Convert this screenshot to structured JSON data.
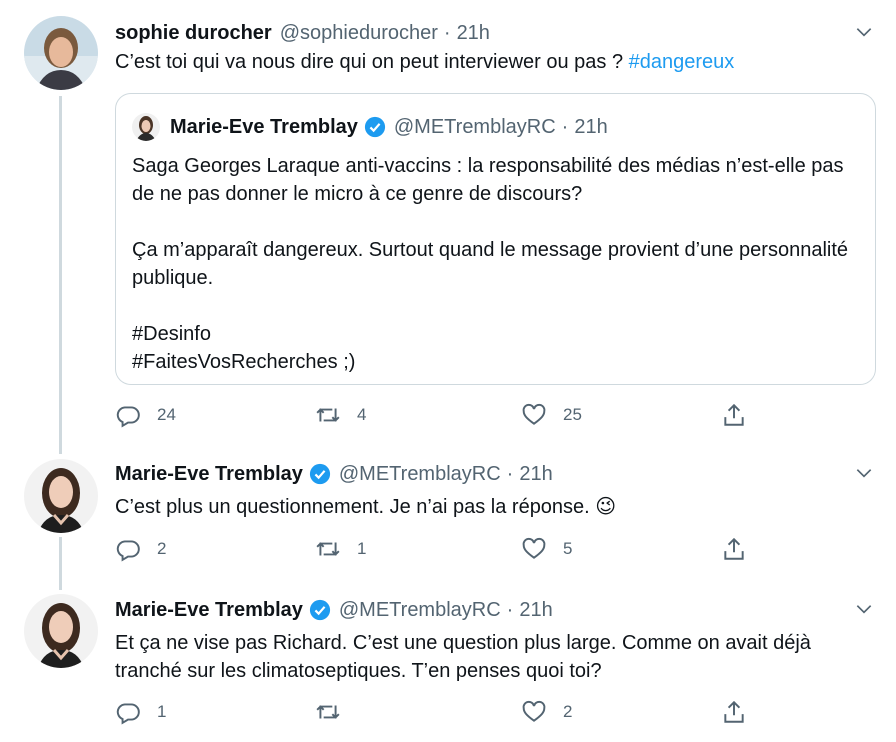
{
  "tweets": [
    {
      "name": "sophie durocher",
      "handle": "@sophiedurocher",
      "time": "21h",
      "text": "C’est toi qui va nous dire qui on peut interviewer ou pas ?",
      "hashtag": "#dangereux",
      "quoted": {
        "name": "Marie-Eve Tremblay",
        "handle": "@METremblayRC",
        "time": "21h",
        "line1": "Saga Georges Laraque anti-vaccins : la responsabilité des médias n’est-elle pas de ne pas donner le micro à ce genre de discours?",
        "line2": "Ça m’apparaît dangereux. Surtout quand le message provient d’une personnalité publique.",
        "tag1": "#Desinfo",
        "tag2": "#FaitesVosRecherches ;)"
      },
      "replies": "24",
      "retweets": "4",
      "likes": "25"
    },
    {
      "name": "Marie-Eve Tremblay",
      "handle": "@METremblayRC",
      "time": "21h",
      "text": "C’est plus un questionnement. Je n’ai pas la réponse. 😉",
      "replies": "2",
      "retweets": "1",
      "likes": "5"
    },
    {
      "name": "Marie-Eve Tremblay",
      "handle": "@METremblayRC",
      "time": "21h",
      "text": "Et ça ne vise pas Richard. C’est une question plus large. Comme on avait déjà tranché sur les climatoseptiques. T’en penses quoi toi?",
      "replies": "1",
      "retweets": "",
      "likes": "2"
    }
  ],
  "separator": "·",
  "icons": {
    "verified": "verified-badge-icon",
    "more": "chevron-down-icon",
    "reply": "reply-icon",
    "retweet": "retweet-icon",
    "like": "heart-icon",
    "share": "share-icon"
  },
  "colors": {
    "accent": "#1d9bf0",
    "text": "#0f1419",
    "muted": "#536471",
    "border": "#cfd9de"
  }
}
